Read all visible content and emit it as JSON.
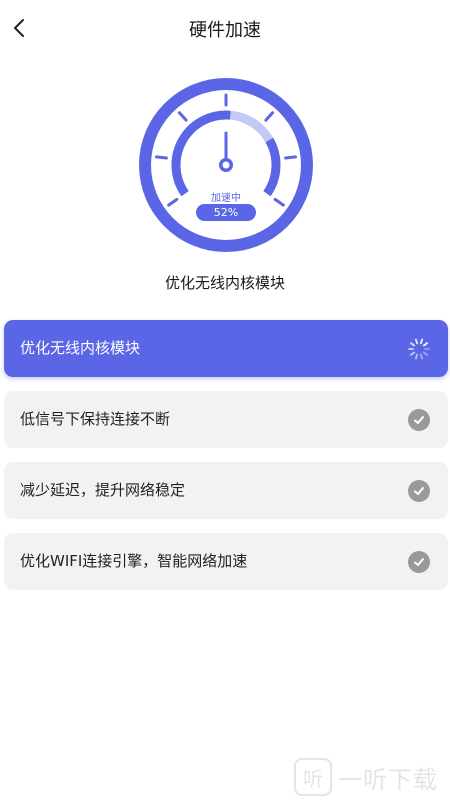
{
  "header": {
    "title": "硬件加速",
    "back_icon": "chevron-left-icon"
  },
  "gauge": {
    "status_label": "加速中",
    "percent_text": "52%",
    "progress": 0.52,
    "accent_color": "#5b66e6",
    "light_color": "#c4c8f4"
  },
  "current_module": "优化无线内核模块",
  "tasks": [
    {
      "label": "优化无线内核模块",
      "state": "in-progress",
      "icon": "spinner-icon"
    },
    {
      "label": "低信号下保持连接不断",
      "state": "done",
      "icon": "check-circle-icon"
    },
    {
      "label": "减少延迟，提升网络稳定",
      "state": "done",
      "icon": "check-circle-icon"
    },
    {
      "label": "优化WIFI连接引擎，智能网络加速",
      "state": "done",
      "icon": "check-circle-icon"
    }
  ],
  "watermark": {
    "icon_glyph": "听",
    "text": "一听下载"
  },
  "colors": {
    "accent": "#5b66e6",
    "done_gray": "#999999",
    "item_bg": "#f2f2f2"
  }
}
